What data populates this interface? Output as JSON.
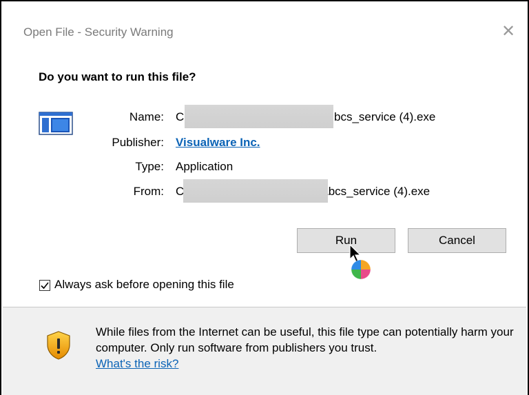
{
  "window": {
    "title": "Open File - Security Warning",
    "close_glyph": "✕"
  },
  "dialog": {
    "heading": "Do you want to run this file?",
    "icon": "application-file-icon",
    "fields": {
      "name_label": "Name:",
      "name_prefix": "C",
      "name_suffix": "bcs_service (4).exe",
      "publisher_label": "Publisher:",
      "publisher_value": "Visualware Inc.",
      "type_label": "Type:",
      "type_value": "Application",
      "from_label": "From:",
      "from_prefix": "C",
      "from_suffix": "\\bcs_service (4).exe"
    },
    "buttons": {
      "run": "Run",
      "cancel": "Cancel"
    },
    "checkbox": {
      "label": "Always ask before opening this file",
      "checked": true
    }
  },
  "warning": {
    "icon": "shield-warning-icon",
    "text": "While files from the Internet can be useful, this file type can potentially harm your computer. Only run software from publishers you trust.",
    "link": "What's the risk?"
  },
  "colors": {
    "link": "#0b63b6",
    "bottom_bg": "#f0f0f0",
    "button_bg": "#e1e1e1"
  }
}
